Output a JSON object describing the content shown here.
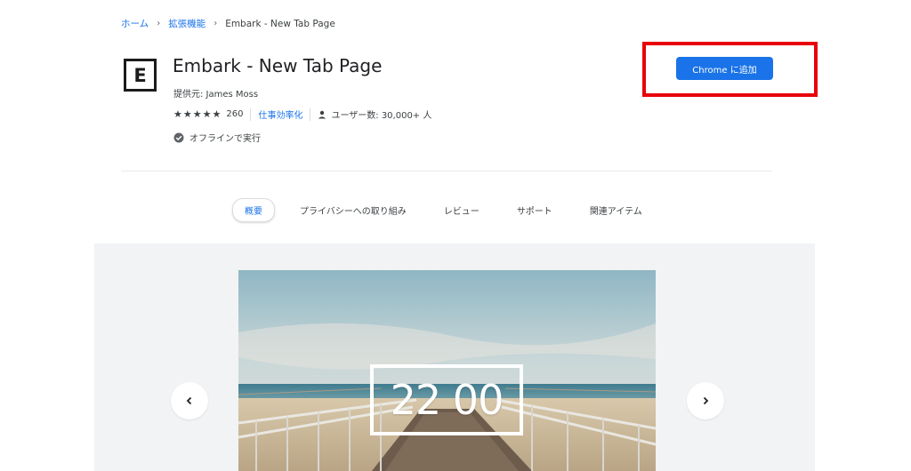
{
  "breadcrumb": {
    "home": "ホーム",
    "extensions": "拡張機能",
    "current": "Embark - New Tab Page",
    "separator": "›"
  },
  "extension": {
    "logo_letter": "E",
    "title": "Embark - New Tab Page",
    "provider": "提供元: James Moss",
    "rating": 4.5,
    "rating_count": "260",
    "category": "仕事効率化",
    "users": "ユーザー数: 30,000+ 人",
    "offline": "オフラインで実行"
  },
  "add_button": {
    "label": "Chrome に追加",
    "highlight_color": "#e8000b",
    "color": "#1a73e8"
  },
  "tabs": [
    {
      "label": "概要",
      "active": true
    },
    {
      "label": "プライバシーへの取り組み",
      "active": false
    },
    {
      "label": "レビュー",
      "active": false
    },
    {
      "label": "サポート",
      "active": false
    },
    {
      "label": "関連アイテム",
      "active": false
    }
  ],
  "carousel": {
    "clock": "22 00",
    "prev_icon": "chevron-left-icon",
    "next_icon": "chevron-right-icon"
  }
}
